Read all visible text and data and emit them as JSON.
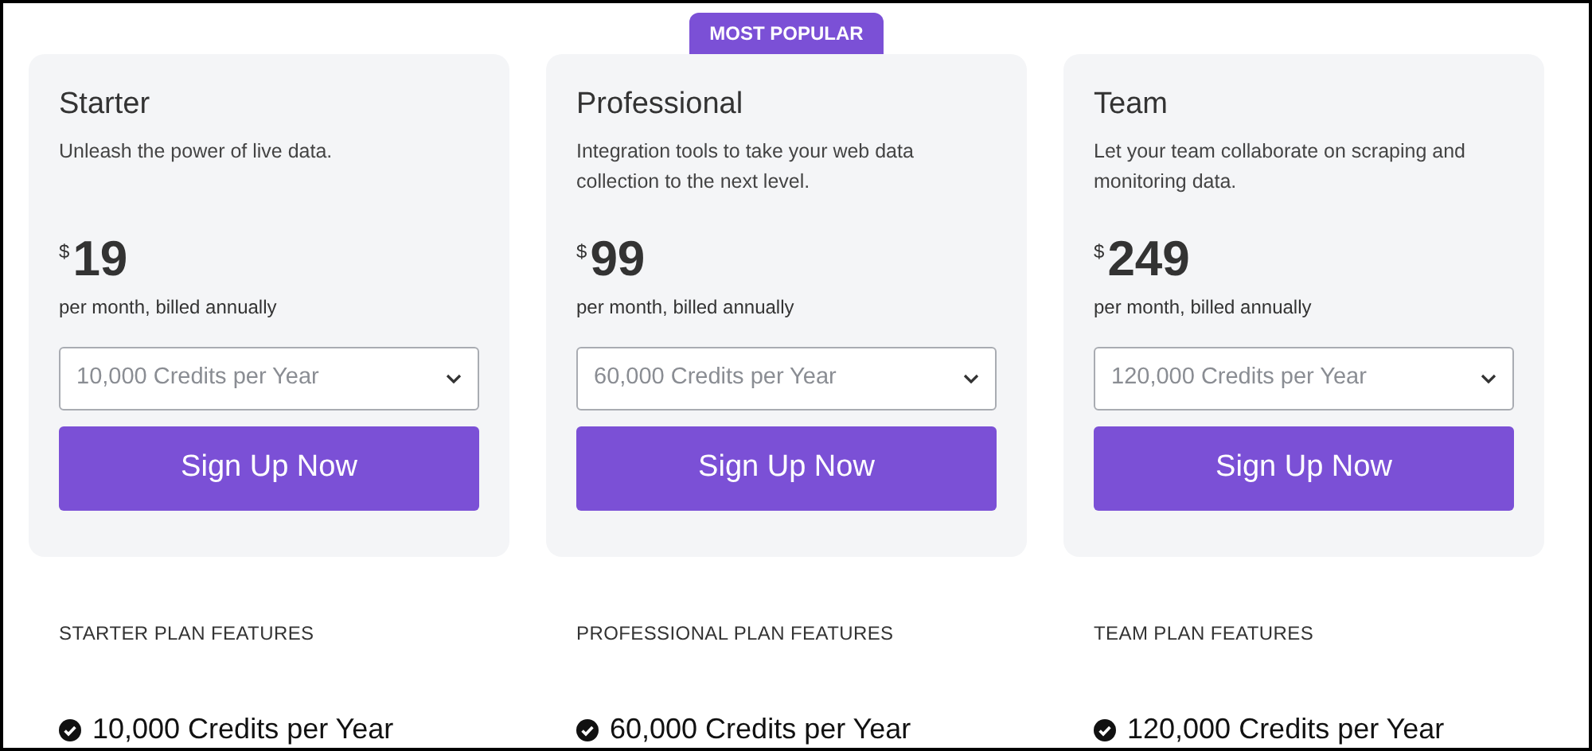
{
  "plans": [
    {
      "name": "Starter",
      "description": "Unleash the power of live data.",
      "currency": "$",
      "price": "19",
      "period": "per month, billed annually",
      "credits_select": {
        "value": "10,000 Credits per Year"
      },
      "button": "Sign Up Now",
      "features_heading": "STARTER PLAN FEATURES",
      "features": [
        "10,000 Credits per Year"
      ]
    },
    {
      "badge": "MOST POPULAR",
      "name": "Professional",
      "description": "Integration tools to take your web data collection to the next level.",
      "currency": "$",
      "price": "99",
      "period": "per month, billed annually",
      "credits_select": {
        "value": "60,000 Credits per Year"
      },
      "button": "Sign Up Now",
      "features_heading": "PROFESSIONAL PLAN FEATURES",
      "features": [
        "60,000 Credits per Year"
      ]
    },
    {
      "name": "Team",
      "description": "Let your team collaborate on scraping and monitoring data.",
      "currency": "$",
      "price": "249",
      "period": "per month, billed annually",
      "credits_select": {
        "value": "120,000 Credits per Year"
      },
      "button": "Sign Up Now",
      "features_heading": "TEAM PLAN FEATURES",
      "features": [
        "120,000 Credits per Year"
      ]
    }
  ]
}
